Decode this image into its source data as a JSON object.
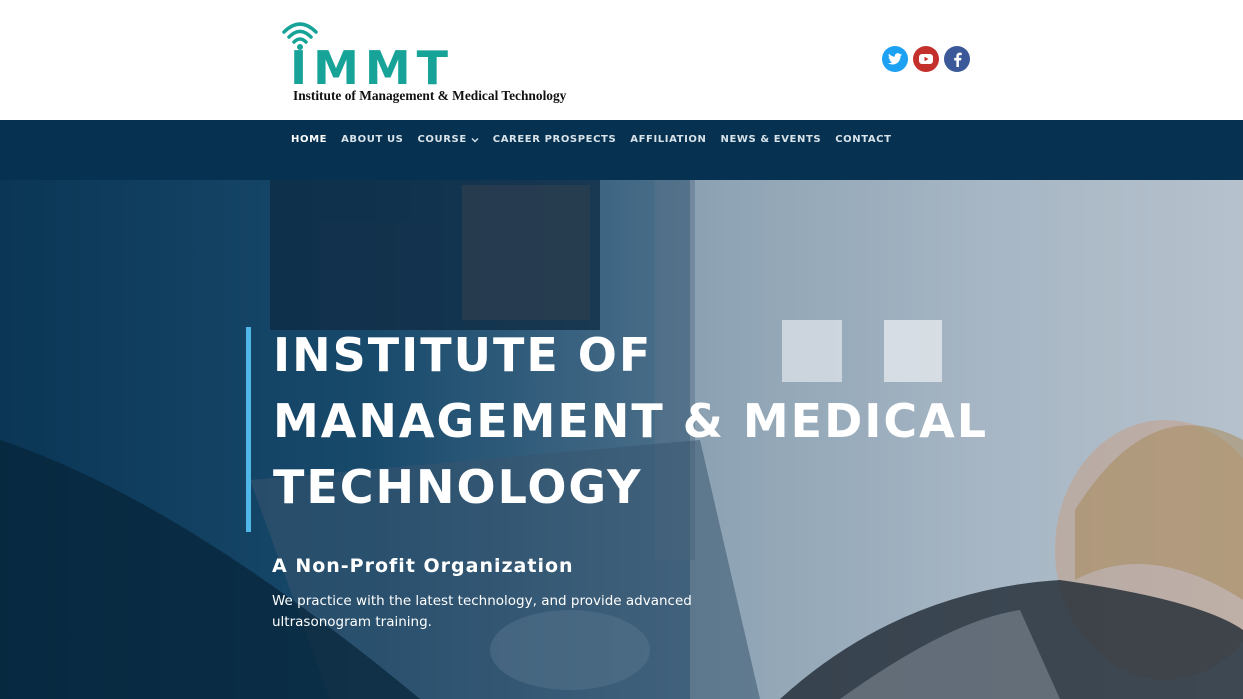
{
  "header": {
    "logo_letters": "IMMT",
    "logo_tagline": "Institute of Management & Medical Technology",
    "colors": {
      "logo_teal": "#17a398"
    },
    "social": [
      {
        "name": "twitter",
        "icon": "twitter-icon",
        "color": "#1da1f2"
      },
      {
        "name": "youtube",
        "icon": "youtube-icon",
        "color": "#c4302b"
      },
      {
        "name": "facebook",
        "icon": "facebook-icon",
        "color": "#3b5998"
      }
    ]
  },
  "nav": {
    "background": "#073150",
    "items": [
      {
        "label": "HOME",
        "active": true
      },
      {
        "label": "ABOUT US"
      },
      {
        "label": "COURSE",
        "has_dropdown": true
      },
      {
        "label": "CAREER PROSPECTS"
      },
      {
        "label": "AFFILIATION"
      },
      {
        "label": "NEWS & EVENTS"
      },
      {
        "label": "CONTACT"
      }
    ]
  },
  "hero": {
    "title_lines": [
      "INSTITUTE OF",
      "MANAGEMENT & MEDICAL",
      "TECHNOLOGY"
    ],
    "subtitle": "A Non-Profit Organization",
    "text_lines": [
      "We practice with the latest technology, and provide advanced",
      "ultrasonogram training."
    ],
    "accent_color": "#4fb8e8"
  }
}
